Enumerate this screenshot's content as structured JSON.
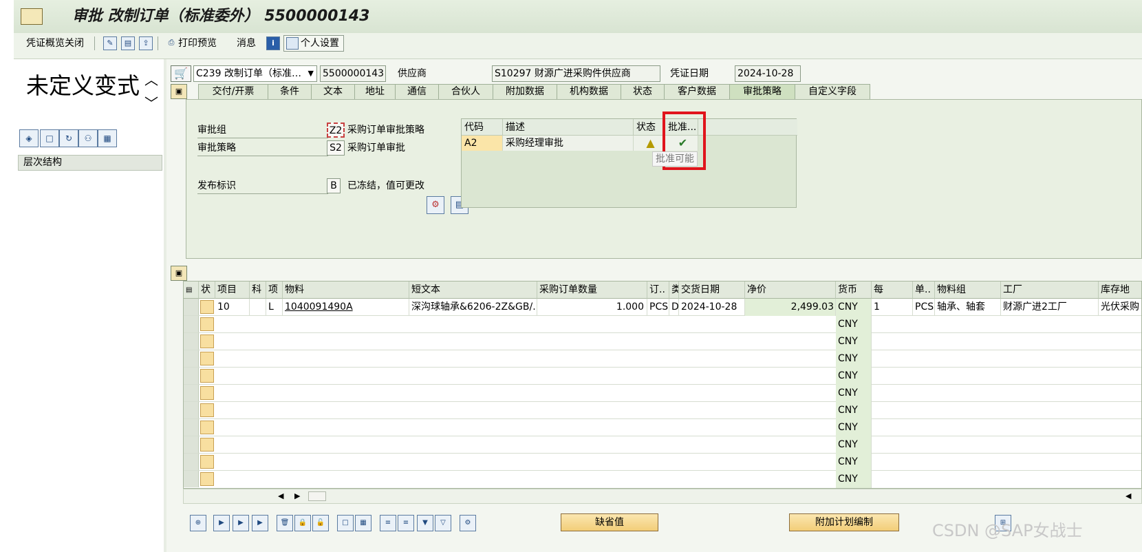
{
  "window": {
    "title": "审批 改制订单（标准委外） 5500000143"
  },
  "toolbar": {
    "overview_close": "凭证概览关闭",
    "print_preview": "打印预览",
    "messages": "消息",
    "personal_settings": "个人设置"
  },
  "left": {
    "variant": "未定义变式",
    "hierarchy": "层次结构"
  },
  "header": {
    "doc_type": "C239 改制订单（标准…",
    "doc_number": "5500000143",
    "vendor_label": "供应商",
    "vendor_value": "S10297 财源广进采购件供应商",
    "doc_date_label": "凭证日期",
    "doc_date_value": "2024-10-28"
  },
  "tabs": [
    "交付/开票",
    "条件",
    "文本",
    "地址",
    "通信",
    "合伙人",
    "附加数据",
    "机构数据",
    "状态",
    "客户数据",
    "审批策略",
    "自定义字段"
  ],
  "active_tab": "审批策略",
  "release": {
    "group_label": "审批组",
    "group_code": "Z2",
    "group_desc": "采购订单审批策略",
    "strategy_label": "审批策略",
    "strategy_code": "S2",
    "strategy_desc": "采购订单审批",
    "indicator_label": "发布标识",
    "indicator_code": "B",
    "indicator_desc": "已冻结，值可更改"
  },
  "approval_grid": {
    "headers": [
      "代码",
      "描述",
      "状态",
      "批准..."
    ],
    "rows": [
      {
        "code": "A2",
        "desc": "采购经理审批",
        "status": "warning",
        "approve": "check"
      }
    ],
    "tooltip": "批准可能"
  },
  "items": {
    "headers": [
      "状",
      "项目",
      "科",
      "项",
      "物料",
      "短文本",
      "采购订单数量",
      "订..",
      "类",
      "交货日期",
      "净价",
      "货币",
      "每",
      "单..",
      "物料组",
      "工厂",
      "库存地"
    ],
    "rows": [
      {
        "item": "10",
        "acct": "",
        "cat": "L",
        "material": "1040091490A",
        "short_text": "深沟球轴承&6206-2Z&GB/…",
        "qty": "1.000",
        "unit": "PCS",
        "cls": "D",
        "delivery": "2024-10-28",
        "price": "2,499.03",
        "currency": "CNY",
        "per": "1",
        "opu": "PCS",
        "mat_group": "轴承、轴套",
        "plant": "财源广进2工厂",
        "sloc": "光伏采购"
      },
      {
        "currency": "CNY"
      },
      {
        "currency": "CNY"
      },
      {
        "currency": "CNY"
      },
      {
        "currency": "CNY"
      },
      {
        "currency": "CNY"
      },
      {
        "currency": "CNY"
      },
      {
        "currency": "CNY"
      },
      {
        "currency": "CNY"
      },
      {
        "currency": "CNY"
      },
      {
        "currency": "CNY"
      }
    ]
  },
  "bottom": {
    "default_values": "缺省值",
    "add_planning": "附加计划编制"
  },
  "watermark": "CSDN @SAP女战士"
}
